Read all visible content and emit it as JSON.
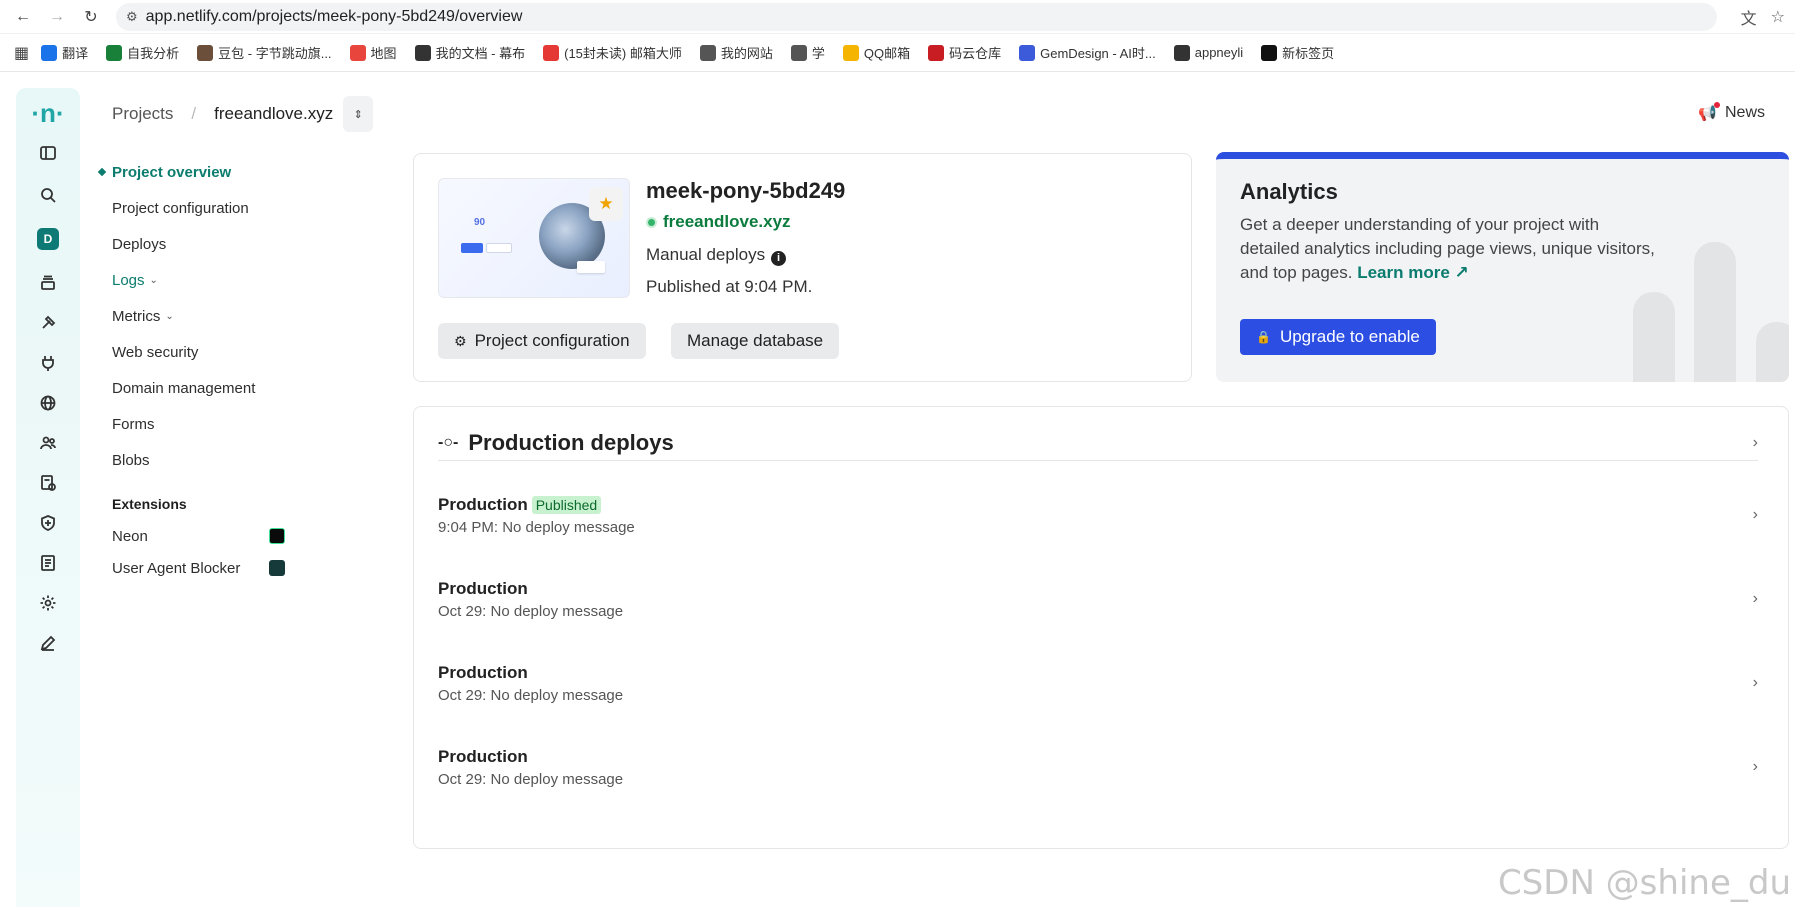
{
  "browser": {
    "url": "app.netlify.com/projects/meek-pony-5bd249/overview",
    "bookmarks": [
      {
        "label": "翻译",
        "icon": "translate-icon",
        "color": "#1a73e8"
      },
      {
        "label": "自我分析",
        "icon": "sheets-icon",
        "color": "#188038"
      },
      {
        "label": "豆包 - 字节跳动旗...",
        "icon": "doubao-icon",
        "color": "#6b4f3a"
      },
      {
        "label": "地图",
        "icon": "map-pin-icon",
        "color": "#e8453c"
      },
      {
        "label": "我的文档 - 幕布",
        "icon": "mubu-icon",
        "color": "#333333"
      },
      {
        "label": "(15封未读) 邮箱大师",
        "icon": "mail-master-icon",
        "color": "#e53935"
      },
      {
        "label": "我的网站",
        "icon": "folder-icon",
        "color": "#555555"
      },
      {
        "label": "学",
        "icon": "folder-icon",
        "color": "#555555"
      },
      {
        "label": "QQ邮箱",
        "icon": "qq-mail-icon",
        "color": "#f4b400"
      },
      {
        "label": "码云仓库",
        "icon": "gitee-icon",
        "color": "#c71d23"
      },
      {
        "label": "GemDesign - AI时...",
        "icon": "gemdesign-icon",
        "color": "#3b5bdb"
      },
      {
        "label": "appneyli",
        "icon": "globe-icon",
        "color": "#333333"
      },
      {
        "label": "新标签页",
        "icon": "github-icon",
        "color": "#111111"
      }
    ]
  },
  "header": {
    "breadcrumb_root": "Projects",
    "breadcrumb_current": "freeandlove.xyz",
    "news_label": "News"
  },
  "sidebar": {
    "items": [
      {
        "label": "Project overview",
        "active": true
      },
      {
        "label": "Project configuration"
      },
      {
        "label": "Deploys"
      },
      {
        "label": "Logs",
        "has_dropdown": true
      },
      {
        "label": "Metrics",
        "has_dropdown": true
      },
      {
        "label": "Web security"
      },
      {
        "label": "Domain management"
      },
      {
        "label": "Forms"
      },
      {
        "label": "Blobs"
      }
    ],
    "extensions_title": "Extensions",
    "extensions": [
      {
        "label": "Neon",
        "icon": "neon-icon"
      },
      {
        "label": "User Agent Blocker",
        "icon": "user-agent-blocker-icon"
      }
    ]
  },
  "rail": {
    "avatar_letter": "D"
  },
  "project": {
    "thumb_number": "90",
    "name": "meek-pony-5bd249",
    "domain": "freeandlove.xyz",
    "deploy_mode": "Manual deploys",
    "published": "Published at 9:04 PM.",
    "config_button": "Project configuration",
    "db_button": "Manage database"
  },
  "analytics": {
    "title": "Analytics",
    "description": "Get a deeper understanding of your project with detailed analytics including page views, unique visitors, and top pages.",
    "learn_more": "Learn more ↗",
    "upgrade_button": "Upgrade to enable",
    "accent": "#2d4fe0"
  },
  "production": {
    "title": "Production deploys",
    "deploys": [
      {
        "title": "Production",
        "badge": "Published",
        "subtitle": "9:04 PM: No deploy message"
      },
      {
        "title": "Production",
        "badge": "",
        "subtitle": "Oct 29: No deploy message"
      },
      {
        "title": "Production",
        "badge": "",
        "subtitle": "Oct 29: No deploy message"
      },
      {
        "title": "Production",
        "badge": "",
        "subtitle": "Oct 29: No deploy message"
      }
    ]
  },
  "watermark": "CSDN @shine_du"
}
